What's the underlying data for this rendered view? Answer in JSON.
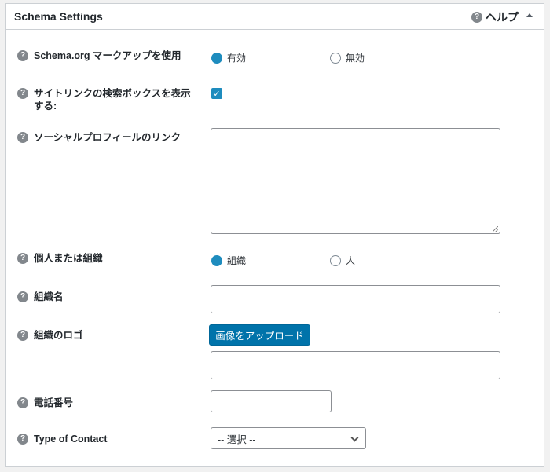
{
  "panel": {
    "title": "Schema Settings",
    "help_label": "ヘルプ"
  },
  "fields": {
    "markup": {
      "label": "Schema.org マークアップを使用",
      "opt_on": "有効",
      "opt_off": "無効",
      "selected": "有効"
    },
    "sitelinks": {
      "label": "サイトリンクの検索ボックスを表示する:",
      "checked": true
    },
    "social": {
      "label": "ソーシャルプロフィールのリンク",
      "value": ""
    },
    "entity": {
      "label": "個人または組織",
      "opt_org": "組織",
      "opt_person": "人",
      "selected": "組織"
    },
    "org_name": {
      "label": "組織名",
      "value": ""
    },
    "org_logo": {
      "label": "組織のロゴ",
      "button": "画像をアップロード",
      "value": ""
    },
    "phone": {
      "label": "電話番号",
      "value": ""
    },
    "contact_type": {
      "label": "Type of Contact",
      "selected": "-- 選択 --"
    }
  },
  "icons": {
    "help": "question-circle-icon",
    "collapse": "triangle-up-icon",
    "checkbox": "checkmark-icon",
    "select": "chevron-down-icon"
  },
  "colors": {
    "accent": "#1e8cbe",
    "button": "#0073aa",
    "border": "#ccd0d4"
  }
}
